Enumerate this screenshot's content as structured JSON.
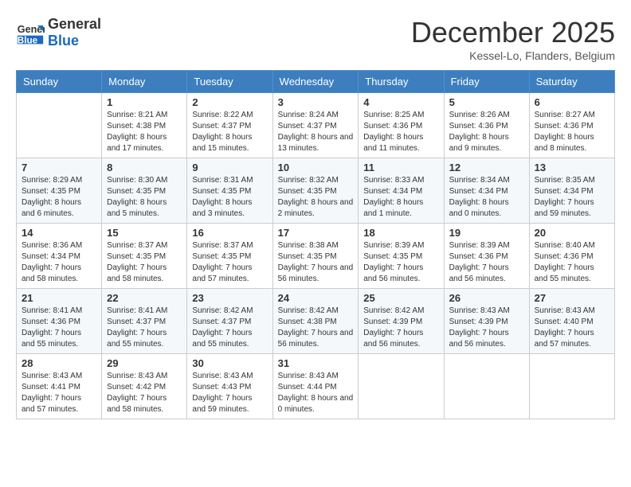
{
  "logo": {
    "general": "General",
    "blue": "Blue"
  },
  "title": "December 2025",
  "location": "Kessel-Lo, Flanders, Belgium",
  "days": [
    "Sunday",
    "Monday",
    "Tuesday",
    "Wednesday",
    "Thursday",
    "Friday",
    "Saturday"
  ],
  "weeks": [
    [
      {
        "day": "",
        "sunrise": "",
        "sunset": "",
        "daylight": ""
      },
      {
        "day": "1",
        "sunrise": "Sunrise: 8:21 AM",
        "sunset": "Sunset: 4:38 PM",
        "daylight": "Daylight: 8 hours and 17 minutes."
      },
      {
        "day": "2",
        "sunrise": "Sunrise: 8:22 AM",
        "sunset": "Sunset: 4:37 PM",
        "daylight": "Daylight: 8 hours and 15 minutes."
      },
      {
        "day": "3",
        "sunrise": "Sunrise: 8:24 AM",
        "sunset": "Sunset: 4:37 PM",
        "daylight": "Daylight: 8 hours and 13 minutes."
      },
      {
        "day": "4",
        "sunrise": "Sunrise: 8:25 AM",
        "sunset": "Sunset: 4:36 PM",
        "daylight": "Daylight: 8 hours and 11 minutes."
      },
      {
        "day": "5",
        "sunrise": "Sunrise: 8:26 AM",
        "sunset": "Sunset: 4:36 PM",
        "daylight": "Daylight: 8 hours and 9 minutes."
      },
      {
        "day": "6",
        "sunrise": "Sunrise: 8:27 AM",
        "sunset": "Sunset: 4:36 PM",
        "daylight": "Daylight: 8 hours and 8 minutes."
      }
    ],
    [
      {
        "day": "7",
        "sunrise": "Sunrise: 8:29 AM",
        "sunset": "Sunset: 4:35 PM",
        "daylight": "Daylight: 8 hours and 6 minutes."
      },
      {
        "day": "8",
        "sunrise": "Sunrise: 8:30 AM",
        "sunset": "Sunset: 4:35 PM",
        "daylight": "Daylight: 8 hours and 5 minutes."
      },
      {
        "day": "9",
        "sunrise": "Sunrise: 8:31 AM",
        "sunset": "Sunset: 4:35 PM",
        "daylight": "Daylight: 8 hours and 3 minutes."
      },
      {
        "day": "10",
        "sunrise": "Sunrise: 8:32 AM",
        "sunset": "Sunset: 4:35 PM",
        "daylight": "Daylight: 8 hours and 2 minutes."
      },
      {
        "day": "11",
        "sunrise": "Sunrise: 8:33 AM",
        "sunset": "Sunset: 4:34 PM",
        "daylight": "Daylight: 8 hours and 1 minute."
      },
      {
        "day": "12",
        "sunrise": "Sunrise: 8:34 AM",
        "sunset": "Sunset: 4:34 PM",
        "daylight": "Daylight: 8 hours and 0 minutes."
      },
      {
        "day": "13",
        "sunrise": "Sunrise: 8:35 AM",
        "sunset": "Sunset: 4:34 PM",
        "daylight": "Daylight: 7 hours and 59 minutes."
      }
    ],
    [
      {
        "day": "14",
        "sunrise": "Sunrise: 8:36 AM",
        "sunset": "Sunset: 4:34 PM",
        "daylight": "Daylight: 7 hours and 58 minutes."
      },
      {
        "day": "15",
        "sunrise": "Sunrise: 8:37 AM",
        "sunset": "Sunset: 4:35 PM",
        "daylight": "Daylight: 7 hours and 58 minutes."
      },
      {
        "day": "16",
        "sunrise": "Sunrise: 8:37 AM",
        "sunset": "Sunset: 4:35 PM",
        "daylight": "Daylight: 7 hours and 57 minutes."
      },
      {
        "day": "17",
        "sunrise": "Sunrise: 8:38 AM",
        "sunset": "Sunset: 4:35 PM",
        "daylight": "Daylight: 7 hours and 56 minutes."
      },
      {
        "day": "18",
        "sunrise": "Sunrise: 8:39 AM",
        "sunset": "Sunset: 4:35 PM",
        "daylight": "Daylight: 7 hours and 56 minutes."
      },
      {
        "day": "19",
        "sunrise": "Sunrise: 8:39 AM",
        "sunset": "Sunset: 4:36 PM",
        "daylight": "Daylight: 7 hours and 56 minutes."
      },
      {
        "day": "20",
        "sunrise": "Sunrise: 8:40 AM",
        "sunset": "Sunset: 4:36 PM",
        "daylight": "Daylight: 7 hours and 55 minutes."
      }
    ],
    [
      {
        "day": "21",
        "sunrise": "Sunrise: 8:41 AM",
        "sunset": "Sunset: 4:36 PM",
        "daylight": "Daylight: 7 hours and 55 minutes."
      },
      {
        "day": "22",
        "sunrise": "Sunrise: 8:41 AM",
        "sunset": "Sunset: 4:37 PM",
        "daylight": "Daylight: 7 hours and 55 minutes."
      },
      {
        "day": "23",
        "sunrise": "Sunrise: 8:42 AM",
        "sunset": "Sunset: 4:37 PM",
        "daylight": "Daylight: 7 hours and 55 minutes."
      },
      {
        "day": "24",
        "sunrise": "Sunrise: 8:42 AM",
        "sunset": "Sunset: 4:38 PM",
        "daylight": "Daylight: 7 hours and 56 minutes."
      },
      {
        "day": "25",
        "sunrise": "Sunrise: 8:42 AM",
        "sunset": "Sunset: 4:39 PM",
        "daylight": "Daylight: 7 hours and 56 minutes."
      },
      {
        "day": "26",
        "sunrise": "Sunrise: 8:43 AM",
        "sunset": "Sunset: 4:39 PM",
        "daylight": "Daylight: 7 hours and 56 minutes."
      },
      {
        "day": "27",
        "sunrise": "Sunrise: 8:43 AM",
        "sunset": "Sunset: 4:40 PM",
        "daylight": "Daylight: 7 hours and 57 minutes."
      }
    ],
    [
      {
        "day": "28",
        "sunrise": "Sunrise: 8:43 AM",
        "sunset": "Sunset: 4:41 PM",
        "daylight": "Daylight: 7 hours and 57 minutes."
      },
      {
        "day": "29",
        "sunrise": "Sunrise: 8:43 AM",
        "sunset": "Sunset: 4:42 PM",
        "daylight": "Daylight: 7 hours and 58 minutes."
      },
      {
        "day": "30",
        "sunrise": "Sunrise: 8:43 AM",
        "sunset": "Sunset: 4:43 PM",
        "daylight": "Daylight: 7 hours and 59 minutes."
      },
      {
        "day": "31",
        "sunrise": "Sunrise: 8:43 AM",
        "sunset": "Sunset: 4:44 PM",
        "daylight": "Daylight: 8 hours and 0 minutes."
      },
      {
        "day": "",
        "sunrise": "",
        "sunset": "",
        "daylight": ""
      },
      {
        "day": "",
        "sunrise": "",
        "sunset": "",
        "daylight": ""
      },
      {
        "day": "",
        "sunrise": "",
        "sunset": "",
        "daylight": ""
      }
    ]
  ]
}
